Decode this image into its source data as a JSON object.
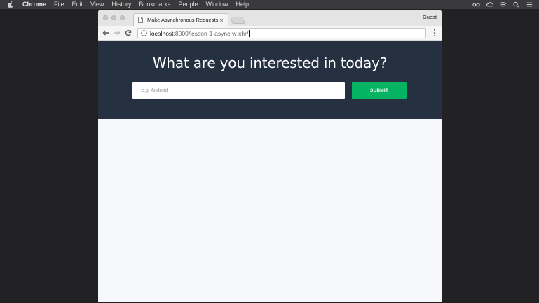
{
  "menubar": {
    "app": "Chrome",
    "items": [
      "File",
      "Edit",
      "View",
      "History",
      "Bookmarks",
      "People",
      "Window",
      "Help"
    ]
  },
  "browser": {
    "tab_title": "Make Asynchronous Requests",
    "tab_close": "×",
    "profile": "Guest",
    "url_host": "localhost",
    "url_rest": ":8000/lesson-1-async-w-xhr/"
  },
  "page": {
    "heading": "What are you interested in today?",
    "search_placeholder": "e.g. Android",
    "submit_label": "SUBMIT"
  },
  "colors": {
    "hero_bg": "#253140",
    "submit_bg": "#04b462",
    "page_bg": "#f7f8fc"
  }
}
